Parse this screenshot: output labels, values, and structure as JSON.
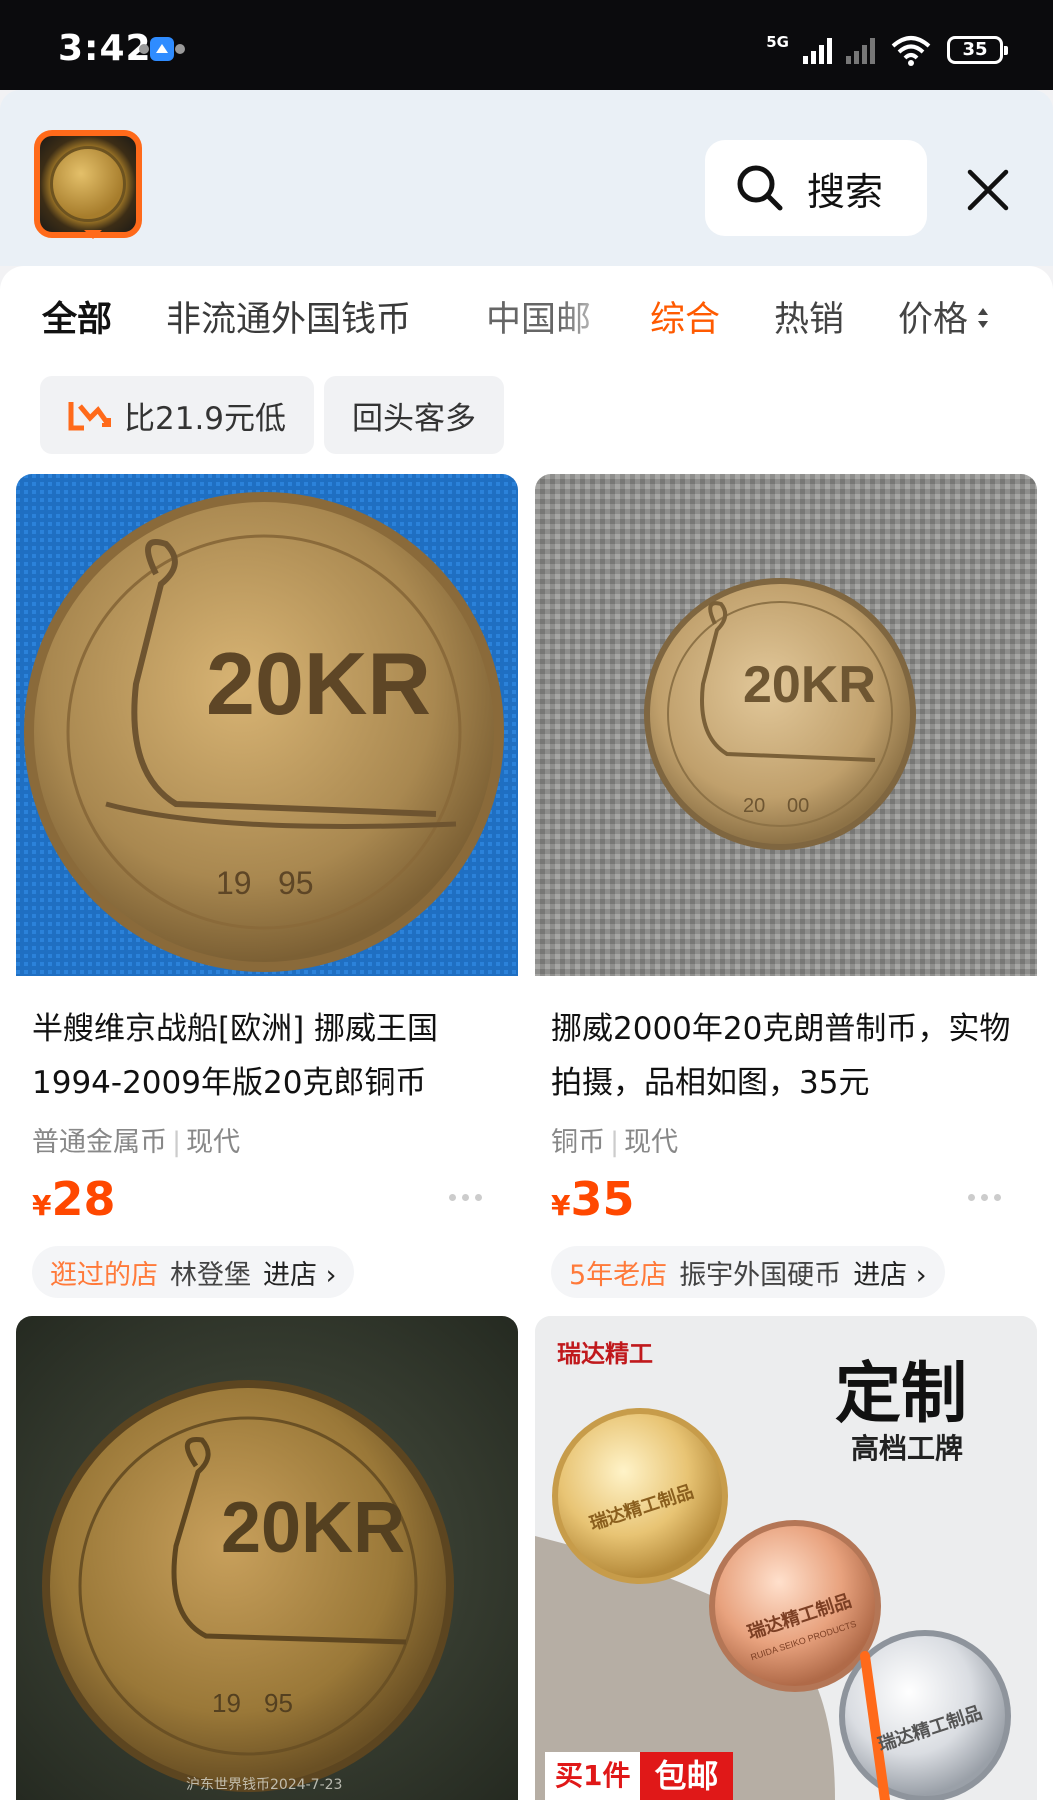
{
  "status_bar": {
    "time": "3:42",
    "network": "5G",
    "battery": "35"
  },
  "header": {
    "search_label": "搜索"
  },
  "category_tabs": [
    "全部",
    "非流通外国钱币",
    "中国邮"
  ],
  "sort_tabs": {
    "comprehensive": "综合",
    "hot": "热销",
    "price": "价格"
  },
  "filter_chips": {
    "price_compare": "比21.9元低",
    "repeat_customers": "回头客多"
  },
  "products": [
    {
      "title": "半艘维京战船[欧洲] 挪威王国1994-2009年版20克郎铜币",
      "tag1": "普通金属币",
      "tag2": "现代",
      "currency": "¥",
      "price": "28",
      "shop_badge": "逛过的店",
      "shop_name": "林登堡",
      "enter_label": "进店 ›",
      "coin_text": "20KR",
      "coin_year": "19",
      "coin_year2": "95"
    },
    {
      "title": "挪威2000年20克朗普制币，实物拍摄，品相如图，35元",
      "tag1": "铜币",
      "tag2": "现代",
      "currency": "¥",
      "price": "35",
      "shop_badge": "5年老店",
      "shop_name": "振宇外国硬币",
      "enter_label": "进店 ›",
      "coin_text": "20KR",
      "coin_year": "20",
      "coin_year2": "00"
    },
    {
      "coin_text": "20KR",
      "coin_year": "19",
      "coin_year2": "95",
      "watermark": "沪东世界钱币2024-7-23"
    },
    {
      "brand": "瑞达精工",
      "headline": "定制",
      "subheadline": "高档工牌",
      "medal_text": "瑞达精工制品",
      "medal_sub": "RUIDA SEIKO PRODUCTS",
      "promo_a": "买1件",
      "promo_b": "包邮"
    }
  ],
  "colors": {
    "accent": "#ff5a00",
    "price": "#ff4800",
    "thumb_border": "#ff6a1a"
  }
}
